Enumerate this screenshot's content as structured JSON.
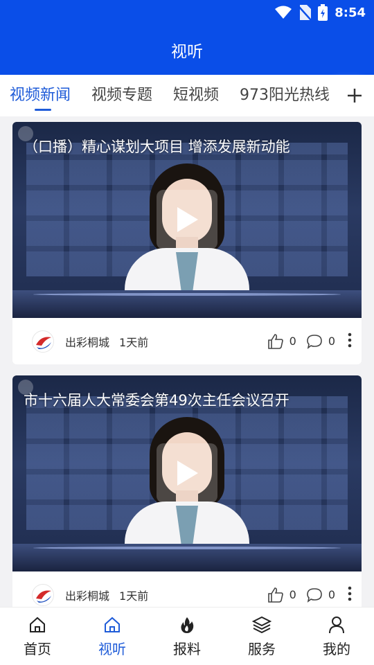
{
  "status_bar": {
    "time": "8:54"
  },
  "header": {
    "title": "视听"
  },
  "tabs": [
    {
      "label": "视频新闻",
      "active": true
    },
    {
      "label": "视频专题",
      "active": false
    },
    {
      "label": "短视频",
      "active": false
    },
    {
      "label": "973阳光热线",
      "active": false
    }
  ],
  "feed": [
    {
      "title": "（口播）精心谋划大项目  增添发展新动能",
      "source": "出彩桐城",
      "age": "1天前",
      "likes": "0",
      "comments": "0"
    },
    {
      "title": "市十六届人大常委会第49次主任会议召开",
      "source": "出彩桐城",
      "age": "1天前",
      "likes": "0",
      "comments": "0"
    }
  ],
  "bottom_nav": [
    {
      "label": "首页",
      "icon": "home-icon",
      "active": false
    },
    {
      "label": "视听",
      "icon": "home-icon",
      "active": true
    },
    {
      "label": "报料",
      "icon": "fire-icon",
      "active": false
    },
    {
      "label": "服务",
      "icon": "layers-icon",
      "active": false
    },
    {
      "label": "我的",
      "icon": "user-icon",
      "active": false
    }
  ],
  "colors": {
    "primary": "#0a4ee8",
    "accent": "#1e5bd8",
    "avatar_red": "#d42a2a",
    "avatar_blue": "#1e4fbf"
  }
}
